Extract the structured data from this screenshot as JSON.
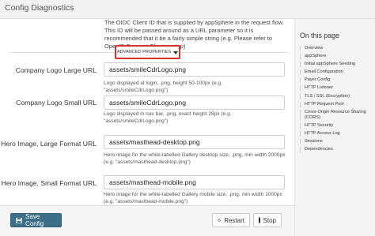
{
  "header": {
    "title": "Config Diagnostics"
  },
  "intro_text": "The OIDC Client ID that is supplied by appSphere in the request flow. This ID will be passed around as a URL parameter so it is recommended that it be a fairly simple string (e.g. Please refer to OpenID Connect Clients setup)",
  "advanced_properties_label": "ADVANCED PROPERTIES",
  "fields": [
    {
      "label": "Company Logo Large URL",
      "value": "assets/smileCdrLogo.png",
      "help": "Logo displayed at login, .png, height 50-100px (e.g. \"assets/smileCdrLogo.png\")"
    },
    {
      "label": "Company Logo Small URL",
      "value": "assets/smileCdrLogo.png",
      "help": "Logo displayed in nav bar, .png, exact height 28px (e.g. \"assets/smileCdrLogo.png\")"
    },
    {
      "label": "Hero Image, Large Format URL",
      "value": "assets/masthead-desktop.png",
      "help": "Hero image for the white-labelled Gallery desktop size, .png, min width 2000px (e.g. \"assets/masthead-desktop.png\")"
    },
    {
      "label": "Hero Image, Small Format URL",
      "value": "assets/masthead-mobile.png",
      "help": "Hero image for the white-labelled Gallery mobile size, .png, min width 1000px (e.g. \"assets/masthead-mobile.png\")"
    }
  ],
  "footer": {
    "save_label": "Save Config",
    "restart_label": "Restart",
    "stop_label": "Stop"
  },
  "toc": {
    "title": "On this page",
    "items": [
      "Overview",
      "appSphere",
      "Initial appSphere Seeding",
      "Email Configuration",
      "Payer Config",
      "HTTP Listener",
      "TLS / SSL (Encryption)",
      "HTTP Request Pool",
      "Cross-Origin Resource Sharing (CORS)",
      "HTTP Security",
      "HTTP Access Log",
      "Sessions",
      "Dependencies"
    ]
  },
  "colors": {
    "accent": "#3c7088",
    "highlight": "#d9312e"
  }
}
